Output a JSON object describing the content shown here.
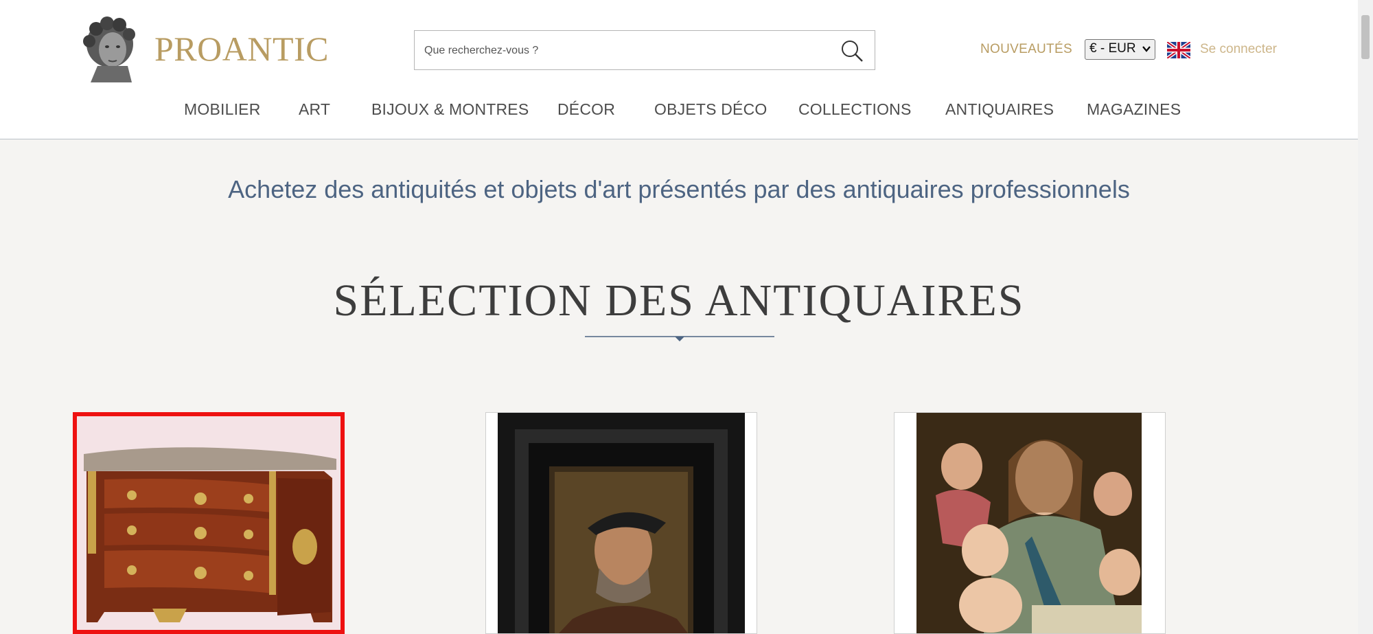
{
  "header": {
    "logo_text": "PROANTIC",
    "search": {
      "placeholder": "Que recherchez-vous ?",
      "value": ""
    },
    "new_label": "NOUVEAUTÉS",
    "currency": "€ - EUR",
    "login_label": "Se connecter"
  },
  "nav": {
    "items": [
      {
        "label": "MOBILIER"
      },
      {
        "label": "ART"
      },
      {
        "label": "BIJOUX & MONTRES"
      },
      {
        "label": "DÉCOR"
      },
      {
        "label": "OBJETS DÉCO"
      },
      {
        "label": "COLLECTIONS"
      },
      {
        "label": "ANTIQUAIRES"
      },
      {
        "label": "MAGAZINES"
      }
    ]
  },
  "main": {
    "tagline": "Achetez des antiquités et objets d'art présentés par des antiquaires professionnels",
    "section_title": "SÉLECTION DES ANTIQUAIRES"
  },
  "colors": {
    "gold": "#b89c62",
    "tagline_blue": "#4d6482",
    "selection_red": "#ee1111"
  }
}
